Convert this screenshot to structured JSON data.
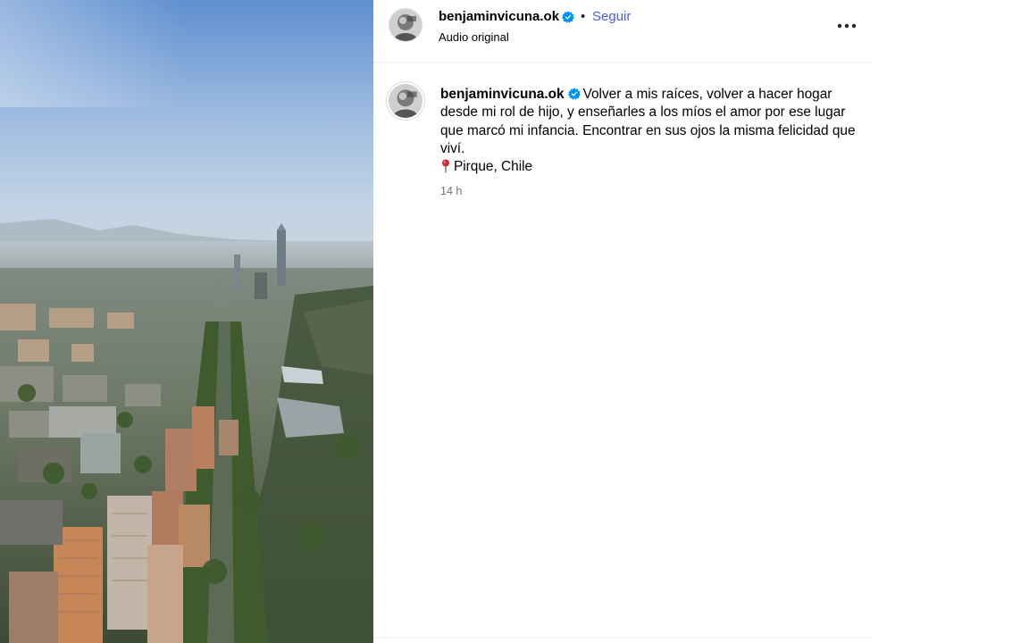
{
  "post_header": {
    "username": "benjaminvicuna.ok",
    "separator": "•",
    "follow_label": "Seguir",
    "audio_label": "Audio original",
    "more_icon": "more-horizontal-icon"
  },
  "caption": {
    "username": "benjaminvicuna.ok",
    "text_line_1": "Volver a mis raíces, volver a hacer hogar desde mi rol de hijo, y enseñarles a los míos el amor por ese lugar que marcó mi infancia. Encontrar en sus ojos la misma felicidad que viví.",
    "location_icon": "round-pushpin-icon",
    "location": "Pirque, Chile",
    "time": "14 h"
  },
  "colors": {
    "follow_blue": "#4a5df9",
    "verified_blue": "#0095f6",
    "muted_gray": "#737373",
    "divider": "#efefef"
  }
}
